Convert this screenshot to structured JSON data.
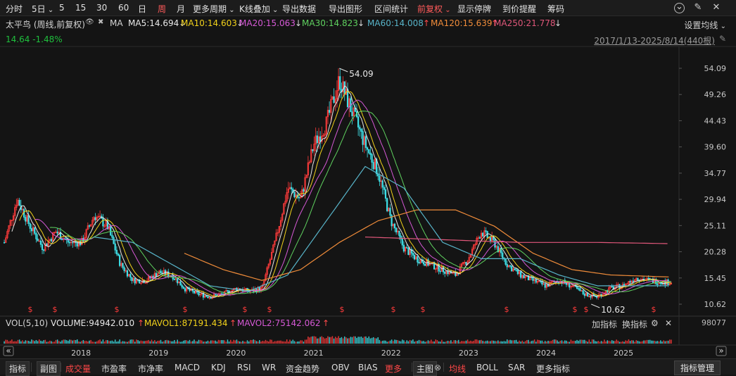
{
  "toolbar": {
    "items": [
      {
        "label": "分时",
        "active": false
      },
      {
        "label": "5日",
        "active": false
      },
      {
        "label": "5",
        "active": false
      },
      {
        "label": "15",
        "active": false
      },
      {
        "label": "30",
        "active": false
      },
      {
        "label": "60",
        "active": false
      },
      {
        "label": "日",
        "active": false
      },
      {
        "label": "周",
        "active": true
      },
      {
        "label": "月",
        "active": false
      },
      {
        "label": "更多周期",
        "active": false
      },
      {
        "label": "K线叠加",
        "active": false
      },
      {
        "label": "导出数据",
        "active": false
      },
      {
        "label": "导出图形",
        "active": false
      },
      {
        "label": "区间统计",
        "active": false
      },
      {
        "label": "前复权",
        "active": true
      },
      {
        "label": "显示停牌",
        "active": false
      },
      {
        "label": "到价提醒",
        "active": false
      },
      {
        "label": "筹码",
        "active": false
      }
    ],
    "chevron": "⌄",
    "right_icons": [
      "chevron-circle-icon",
      "pen-icon",
      "close-icon"
    ]
  },
  "ma_bar": {
    "stock": "太平鸟 (周线,前复权)",
    "ma_label": "MA",
    "entries": [
      {
        "text": "MA5:14.694",
        "arrow": "↓",
        "color": "#e8e8e8"
      },
      {
        "text": "MA10:14.603",
        "arrow": "↓",
        "color": "#f2d21b"
      },
      {
        "text": "MA20:15.063",
        "arrow": "↓",
        "color": "#d659d6"
      },
      {
        "text": "MA30:14.823",
        "arrow": "↓",
        "color": "#5fd15f"
      },
      {
        "text": "MA60:14.008",
        "arrow": "↑",
        "color": "#58b4c9"
      },
      {
        "text": "MA120:15.639",
        "arrow": "↑",
        "color": "#f08c3a"
      },
      {
        "text": "MA250:21.778",
        "arrow": "↓",
        "color": "#e0577a"
      }
    ],
    "settings": "设置均线"
  },
  "quote": {
    "price": "14.64",
    "change": "-1.48%"
  },
  "range": "2017/1/13-2025/8/14(440根)",
  "volume_bar": {
    "title": "VOL(5,10)",
    "volume": "VOLUME:94942.010",
    "mavol1": "MAVOL1:87191.434",
    "mavol2": "MAVOL2:75142.062",
    "add_indicator": "加指标",
    "switch_indicator": "换指标",
    "axis_value": "98077"
  },
  "indicator_bar": {
    "items": [
      {
        "label": "指标",
        "style": "box"
      },
      {
        "label": "副图",
        "style": "box"
      },
      {
        "label": "成交量",
        "style": "red"
      },
      {
        "label": "市盈率",
        "style": ""
      },
      {
        "label": "市净率",
        "style": ""
      },
      {
        "label": "MACD",
        "style": ""
      },
      {
        "label": "KDJ",
        "style": ""
      },
      {
        "label": "RSI",
        "style": ""
      },
      {
        "label": "WR",
        "style": ""
      },
      {
        "label": "资金趋势",
        "style": ""
      },
      {
        "label": "OBV",
        "style": ""
      },
      {
        "label": "BIAS",
        "style": ""
      },
      {
        "label": "更多",
        "style": "red"
      },
      {
        "label": "主图",
        "style": "box"
      },
      {
        "label": "均线",
        "style": "red"
      },
      {
        "label": "BOLL",
        "style": ""
      },
      {
        "label": "SAR",
        "style": ""
      },
      {
        "label": "更多指标",
        "style": ""
      }
    ],
    "manager": "指标管理"
  },
  "chart_data": {
    "type": "candlestick",
    "period": "weekly",
    "y_ticks": [
      54.09,
      49.26,
      44.43,
      39.6,
      34.77,
      29.94,
      25.11,
      20.28,
      15.45,
      10.62
    ],
    "ylim": [
      10.62,
      54.09
    ],
    "x_labels": [
      "2018",
      "2019",
      "2020",
      "2021",
      "2022",
      "2023",
      "2024",
      "2025"
    ],
    "annotations": [
      {
        "label": "54.09",
        "value": 54.09,
        "date": "2021-05"
      },
      {
        "label": "10.62",
        "value": 10.62,
        "date": "2024-08"
      }
    ],
    "dividend_marker": "$",
    "price_series": [
      {
        "date": "2017-01",
        "value": 22.0
      },
      {
        "date": "2017-03",
        "value": 30.0
      },
      {
        "date": "2017-05",
        "value": 25.0
      },
      {
        "date": "2017-07",
        "value": 21.0
      },
      {
        "date": "2017-09",
        "value": 24.0
      },
      {
        "date": "2017-11",
        "value": 22.0
      },
      {
        "date": "2018-01",
        "value": 22.0
      },
      {
        "date": "2018-03",
        "value": 27.0
      },
      {
        "date": "2018-05",
        "value": 25.0
      },
      {
        "date": "2018-07",
        "value": 18.0
      },
      {
        "date": "2018-09",
        "value": 15.0
      },
      {
        "date": "2018-11",
        "value": 15.0
      },
      {
        "date": "2019-01",
        "value": 16.5
      },
      {
        "date": "2019-03",
        "value": 16.0
      },
      {
        "date": "2019-05",
        "value": 13.5
      },
      {
        "date": "2019-07",
        "value": 12.5
      },
      {
        "date": "2019-09",
        "value": 12.0
      },
      {
        "date": "2019-11",
        "value": 12.5
      },
      {
        "date": "2020-01",
        "value": 13.5
      },
      {
        "date": "2020-03",
        "value": 13.0
      },
      {
        "date": "2020-05",
        "value": 13.5
      },
      {
        "date": "2020-07",
        "value": 22.0
      },
      {
        "date": "2020-09",
        "value": 32.0
      },
      {
        "date": "2020-11",
        "value": 30.0
      },
      {
        "date": "2021-01",
        "value": 40.0
      },
      {
        "date": "2021-03",
        "value": 44.0
      },
      {
        "date": "2021-05",
        "value": 52.0
      },
      {
        "date": "2021-07",
        "value": 46.0
      },
      {
        "date": "2021-09",
        "value": 40.0
      },
      {
        "date": "2021-11",
        "value": 35.0
      },
      {
        "date": "2022-01",
        "value": 26.0
      },
      {
        "date": "2022-03",
        "value": 21.0
      },
      {
        "date": "2022-05",
        "value": 19.0
      },
      {
        "date": "2022-07",
        "value": 18.0
      },
      {
        "date": "2022-09",
        "value": 17.0
      },
      {
        "date": "2022-11",
        "value": 16.0
      },
      {
        "date": "2023-01",
        "value": 19.0
      },
      {
        "date": "2023-03",
        "value": 24.0
      },
      {
        "date": "2023-05",
        "value": 22.0
      },
      {
        "date": "2023-07",
        "value": 18.0
      },
      {
        "date": "2023-09",
        "value": 16.0
      },
      {
        "date": "2023-11",
        "value": 15.0
      },
      {
        "date": "2024-01",
        "value": 14.0
      },
      {
        "date": "2024-03",
        "value": 15.0
      },
      {
        "date": "2024-05",
        "value": 14.0
      },
      {
        "date": "2024-07",
        "value": 12.5
      },
      {
        "date": "2024-09",
        "value": 12.0
      },
      {
        "date": "2024-11",
        "value": 13.5
      },
      {
        "date": "2025-01",
        "value": 14.0
      },
      {
        "date": "2025-03",
        "value": 15.5
      },
      {
        "date": "2025-05",
        "value": 15.0
      },
      {
        "date": "2025-08",
        "value": 14.64
      }
    ],
    "ma_series": [
      {
        "name": "MA120",
        "color": "#f08c3a",
        "points": [
          {
            "date": "2019-05",
            "value": 20.0
          },
          {
            "date": "2019-11",
            "value": 17.0
          },
          {
            "date": "2020-05",
            "value": 15.0
          },
          {
            "date": "2020-11",
            "value": 17.0
          },
          {
            "date": "2021-05",
            "value": 22.0
          },
          {
            "date": "2021-11",
            "value": 26.0
          },
          {
            "date": "2022-05",
            "value": 28.0
          },
          {
            "date": "2022-11",
            "value": 28.0
          },
          {
            "date": "2023-05",
            "value": 25.0
          },
          {
            "date": "2023-11",
            "value": 20.0
          },
          {
            "date": "2024-05",
            "value": 17.0
          },
          {
            "date": "2024-11",
            "value": 16.0
          },
          {
            "date": "2025-08",
            "value": 15.639
          }
        ]
      },
      {
        "name": "MA250",
        "color": "#e0577a",
        "points": [
          {
            "date": "2021-09",
            "value": 23.0
          },
          {
            "date": "2022-09",
            "value": 22.5
          },
          {
            "date": "2023-09",
            "value": 22.0
          },
          {
            "date": "2024-09",
            "value": 22.0
          },
          {
            "date": "2025-08",
            "value": 21.778
          }
        ]
      },
      {
        "name": "MA60",
        "color": "#58b4c9",
        "points": [
          {
            "date": "2018-03",
            "value": 23.0
          },
          {
            "date": "2018-09",
            "value": 22.0
          },
          {
            "date": "2019-03",
            "value": 18.0
          },
          {
            "date": "2019-09",
            "value": 14.0
          },
          {
            "date": "2020-03",
            "value": 13.0
          },
          {
            "date": "2020-09",
            "value": 16.0
          },
          {
            "date": "2021-03",
            "value": 26.0
          },
          {
            "date": "2021-09",
            "value": 36.0
          },
          {
            "date": "2022-03",
            "value": 32.0
          },
          {
            "date": "2022-09",
            "value": 22.0
          },
          {
            "date": "2023-03",
            "value": 19.0
          },
          {
            "date": "2023-09",
            "value": 19.0
          },
          {
            "date": "2024-03",
            "value": 16.0
          },
          {
            "date": "2024-09",
            "value": 14.0
          },
          {
            "date": "2025-08",
            "value": 14.008
          }
        ]
      }
    ]
  }
}
